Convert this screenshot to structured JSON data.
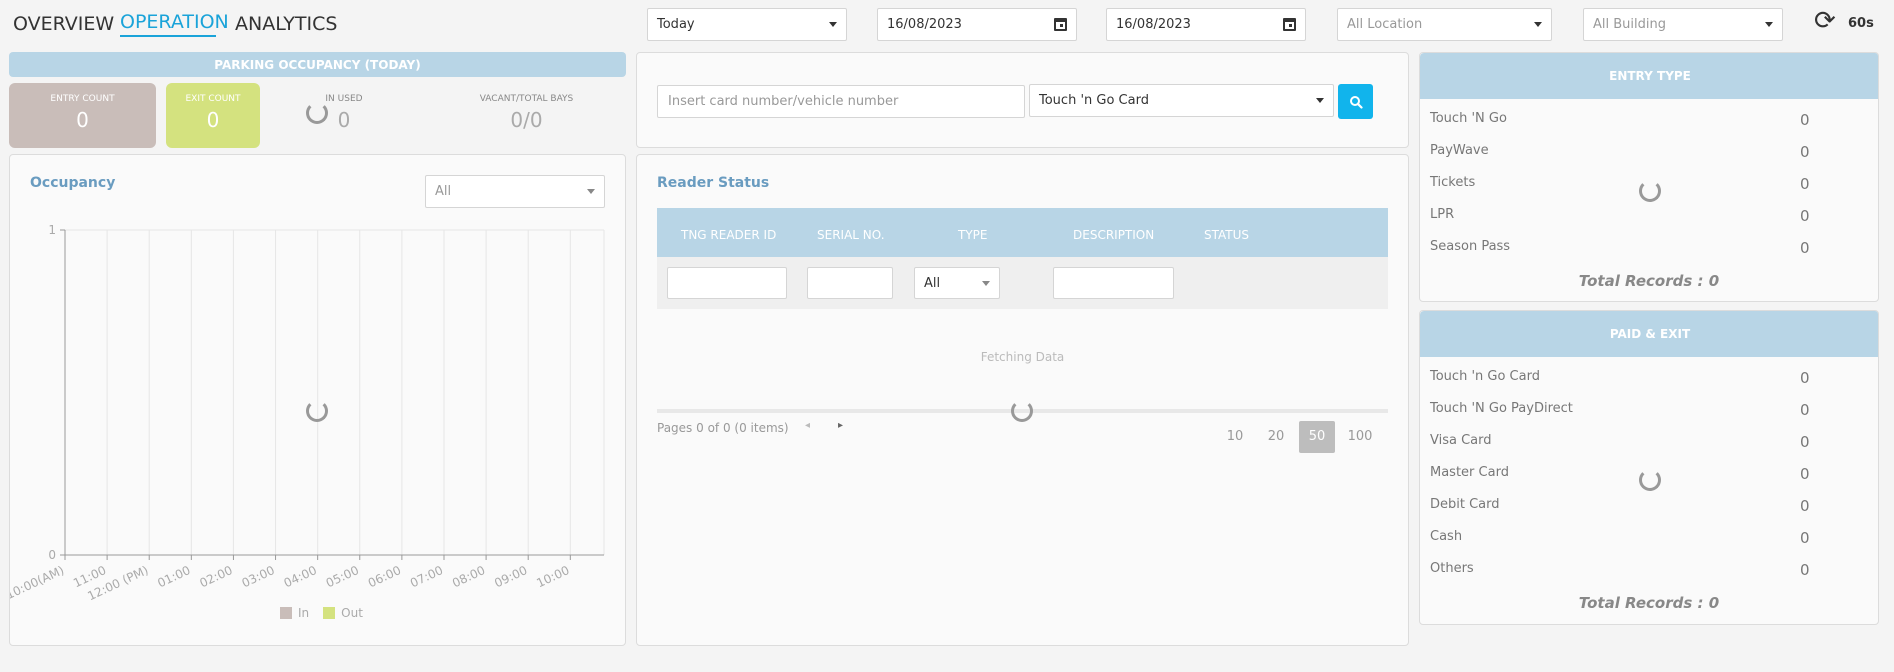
{
  "nav": {
    "tabs": [
      "OVERVIEW",
      "OPERATION",
      "ANALYTICS"
    ],
    "active": "OPERATION"
  },
  "filters": {
    "period": "Today",
    "date_from": "16/08/2023",
    "date_to": "16/08/2023",
    "location": "All Location",
    "building": "All Building",
    "refresh_interval": "60s"
  },
  "occupancy": {
    "header": "PARKING OCCUPANCY (TODAY)",
    "entry_label": "ENTRY COUNT",
    "entry_value": "0",
    "exit_label": "EXIT COUNT",
    "exit_value": "0",
    "in_used_label": "IN USED",
    "in_used_value": "0",
    "vacant_label": "VACANT/TOTAL BAYS",
    "vacant_value": "0/0"
  },
  "occupancy_chart": {
    "title": "Occupancy",
    "filter_value": "All",
    "legend": [
      "In",
      "Out"
    ]
  },
  "chart_data": {
    "type": "line",
    "title": "Occupancy",
    "x": [
      "10:00(AM)",
      "11:00",
      "12:00 (PM)",
      "01:00",
      "02:00",
      "03:00",
      "04:00",
      "05:00",
      "06:00",
      "07:00",
      "08:00",
      "09:00",
      "10:00"
    ],
    "series": [
      {
        "name": "In",
        "values": []
      },
      {
        "name": "Out",
        "values": []
      }
    ],
    "ylim": [
      0,
      1
    ],
    "yticks": [
      "0",
      "1"
    ],
    "grid": true,
    "legend_position": "bottom",
    "colors": {
      "In": "#c9bdb9",
      "Out": "#d4e27f"
    }
  },
  "search": {
    "placeholder": "Insert card number/vehicle number",
    "card_type": "Touch 'n Go Card"
  },
  "reader_status": {
    "title": "Reader Status",
    "columns": [
      "TNG READER ID",
      "SERIAL NO.",
      "TYPE",
      "DESCRIPTION",
      "STATUS"
    ],
    "type_filter": "All",
    "fetching_text": "Fetching Data",
    "pager_text": "Pages 0 of 0 (0 items)",
    "page_sizes": [
      "10",
      "20",
      "50",
      "100"
    ],
    "active_page_size": "50"
  },
  "entry_type": {
    "header": "ENTRY TYPE",
    "rows": [
      {
        "label": "Touch 'N Go",
        "value": "0"
      },
      {
        "label": "PayWave",
        "value": "0"
      },
      {
        "label": "Tickets",
        "value": "0"
      },
      {
        "label": "LPR",
        "value": "0"
      },
      {
        "label": "Season Pass",
        "value": "0"
      }
    ],
    "total": "Total Records : 0"
  },
  "paid_exit": {
    "header": "PAID & EXIT",
    "rows": [
      {
        "label": "Touch 'n Go Card",
        "value": "0"
      },
      {
        "label": "Touch 'N Go PayDirect",
        "value": "0"
      },
      {
        "label": "Visa Card",
        "value": "0"
      },
      {
        "label": "Master Card",
        "value": "0"
      },
      {
        "label": "Debit Card",
        "value": "0"
      },
      {
        "label": "Cash",
        "value": "0"
      },
      {
        "label": "Others",
        "value": "0"
      }
    ],
    "total": "Total Records : 0"
  },
  "colors": {
    "accent": "#1aa3d9",
    "header_blue": "#b8d5e6",
    "entry_box": "#c9bdb9",
    "exit_box": "#d4e27f",
    "search_button": "#11b4ec"
  }
}
